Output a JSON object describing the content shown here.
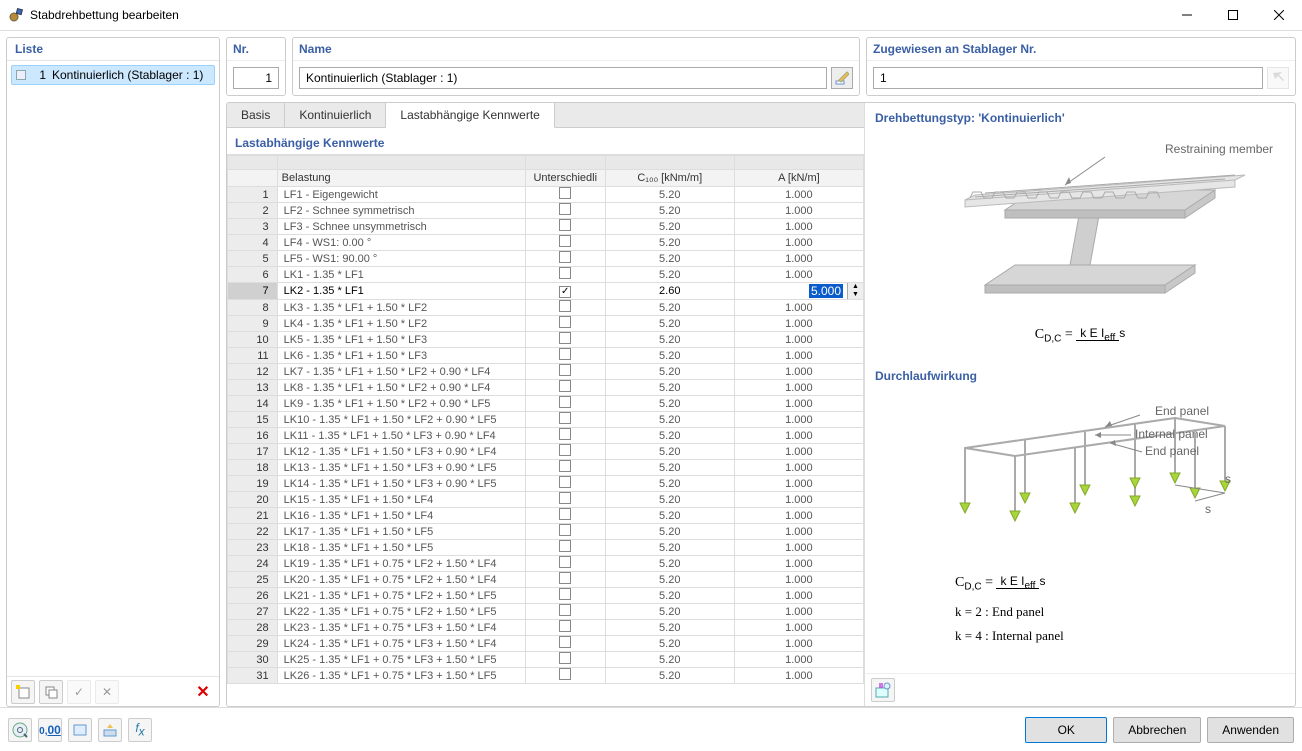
{
  "window": {
    "title": "Stabdrehbettung bearbeiten"
  },
  "sidebar": {
    "head": "Liste",
    "items": [
      {
        "num": "1",
        "label": "Kontinuierlich (Stablager : 1)"
      }
    ]
  },
  "top": {
    "nr_head": "Nr.",
    "nr_value": "1",
    "name_head": "Name",
    "name_value": "Kontinuierlich (Stablager : 1)",
    "assigned_head": "Zugewiesen an Stablager Nr.",
    "assigned_value": "1"
  },
  "tabs": {
    "basis": "Basis",
    "kont": "Kontinuierlich",
    "last": "Lastabhängige Kennwerte"
  },
  "section_title": "Lastabhängige Kennwerte",
  "headers": {
    "load": "Belastung",
    "diff": "Unterschiedli",
    "c100": "C₁₀₀ [kNm/m]",
    "a": "A [kN/m]"
  },
  "rows": [
    {
      "n": 1,
      "load": "LF1 - Eigengewicht",
      "diff": false,
      "c100": "5.20",
      "a": "1.000"
    },
    {
      "n": 2,
      "load": "LF2 - Schnee symmetrisch",
      "diff": false,
      "c100": "5.20",
      "a": "1.000"
    },
    {
      "n": 3,
      "load": "LF3 - Schnee unsymmetrisch",
      "diff": false,
      "c100": "5.20",
      "a": "1.000"
    },
    {
      "n": 4,
      "load": "LF4 - WS1: 0.00 °",
      "diff": false,
      "c100": "5.20",
      "a": "1.000"
    },
    {
      "n": 5,
      "load": "LF5 - WS1: 90.00 °",
      "diff": false,
      "c100": "5.20",
      "a": "1.000"
    },
    {
      "n": 6,
      "load": "LK1 - 1.35 * LF1",
      "diff": false,
      "c100": "5.20",
      "a": "1.000"
    },
    {
      "n": 7,
      "load": "LK2 - 1.35 * LF1",
      "diff": true,
      "c100": "2.60",
      "a": "5.000",
      "selected": true
    },
    {
      "n": 8,
      "load": "LK3 - 1.35 * LF1 + 1.50 * LF2",
      "diff": false,
      "c100": "5.20",
      "a": "1.000"
    },
    {
      "n": 9,
      "load": "LK4 - 1.35 * LF1 + 1.50 * LF2",
      "diff": false,
      "c100": "5.20",
      "a": "1.000"
    },
    {
      "n": 10,
      "load": "LK5 - 1.35 * LF1 + 1.50 * LF3",
      "diff": false,
      "c100": "5.20",
      "a": "1.000"
    },
    {
      "n": 11,
      "load": "LK6 - 1.35 * LF1 + 1.50 * LF3",
      "diff": false,
      "c100": "5.20",
      "a": "1.000"
    },
    {
      "n": 12,
      "load": "LK7 - 1.35 * LF1 + 1.50 * LF2 + 0.90 * LF4",
      "diff": false,
      "c100": "5.20",
      "a": "1.000"
    },
    {
      "n": 13,
      "load": "LK8 - 1.35 * LF1 + 1.50 * LF2 + 0.90 * LF4",
      "diff": false,
      "c100": "5.20",
      "a": "1.000"
    },
    {
      "n": 14,
      "load": "LK9 - 1.35 * LF1 + 1.50 * LF2 + 0.90 * LF5",
      "diff": false,
      "c100": "5.20",
      "a": "1.000"
    },
    {
      "n": 15,
      "load": "LK10 - 1.35 * LF1 + 1.50 * LF2 + 0.90 * LF5",
      "diff": false,
      "c100": "5.20",
      "a": "1.000"
    },
    {
      "n": 16,
      "load": "LK11 - 1.35 * LF1 + 1.50 * LF3 + 0.90 * LF4",
      "diff": false,
      "c100": "5.20",
      "a": "1.000"
    },
    {
      "n": 17,
      "load": "LK12 - 1.35 * LF1 + 1.50 * LF3 + 0.90 * LF4",
      "diff": false,
      "c100": "5.20",
      "a": "1.000"
    },
    {
      "n": 18,
      "load": "LK13 - 1.35 * LF1 + 1.50 * LF3 + 0.90 * LF5",
      "diff": false,
      "c100": "5.20",
      "a": "1.000"
    },
    {
      "n": 19,
      "load": "LK14 - 1.35 * LF1 + 1.50 * LF3 + 0.90 * LF5",
      "diff": false,
      "c100": "5.20",
      "a": "1.000"
    },
    {
      "n": 20,
      "load": "LK15 - 1.35 * LF1 + 1.50 * LF4",
      "diff": false,
      "c100": "5.20",
      "a": "1.000"
    },
    {
      "n": 21,
      "load": "LK16 - 1.35 * LF1 + 1.50 * LF4",
      "diff": false,
      "c100": "5.20",
      "a": "1.000"
    },
    {
      "n": 22,
      "load": "LK17 - 1.35 * LF1 + 1.50 * LF5",
      "diff": false,
      "c100": "5.20",
      "a": "1.000"
    },
    {
      "n": 23,
      "load": "LK18 - 1.35 * LF1 + 1.50 * LF5",
      "diff": false,
      "c100": "5.20",
      "a": "1.000"
    },
    {
      "n": 24,
      "load": "LK19 - 1.35 * LF1 + 0.75 * LF2 + 1.50 * LF4",
      "diff": false,
      "c100": "5.20",
      "a": "1.000"
    },
    {
      "n": 25,
      "load": "LK20 - 1.35 * LF1 + 0.75 * LF2 + 1.50 * LF4",
      "diff": false,
      "c100": "5.20",
      "a": "1.000"
    },
    {
      "n": 26,
      "load": "LK21 - 1.35 * LF1 + 0.75 * LF2 + 1.50 * LF5",
      "diff": false,
      "c100": "5.20",
      "a": "1.000"
    },
    {
      "n": 27,
      "load": "LK22 - 1.35 * LF1 + 0.75 * LF2 + 1.50 * LF5",
      "diff": false,
      "c100": "5.20",
      "a": "1.000"
    },
    {
      "n": 28,
      "load": "LK23 - 1.35 * LF1 + 0.75 * LF3 + 1.50 * LF4",
      "diff": false,
      "c100": "5.20",
      "a": "1.000"
    },
    {
      "n": 29,
      "load": "LK24 - 1.35 * LF1 + 0.75 * LF3 + 1.50 * LF4",
      "diff": false,
      "c100": "5.20",
      "a": "1.000"
    },
    {
      "n": 30,
      "load": "LK25 - 1.35 * LF1 + 0.75 * LF3 + 1.50 * LF5",
      "diff": false,
      "c100": "5.20",
      "a": "1.000"
    },
    {
      "n": 31,
      "load": "LK26 - 1.35 * LF1 + 0.75 * LF3 + 1.50 * LF5",
      "diff": false,
      "c100": "5.20",
      "a": "1.000"
    }
  ],
  "info": {
    "type_head": "Drehbettungstyp: 'Kontinuierlich'",
    "restraining": "Restraining member",
    "durchlauf_head": "Durchlaufwirkung",
    "end_panel": "End panel",
    "internal_panel": "Internal panel",
    "s": "s",
    "k2": "k  =  2 : End  panel",
    "k4": "k  =  4 : Internal  panel"
  },
  "buttons": {
    "ok": "OK",
    "cancel": "Abbrechen",
    "apply": "Anwenden"
  }
}
